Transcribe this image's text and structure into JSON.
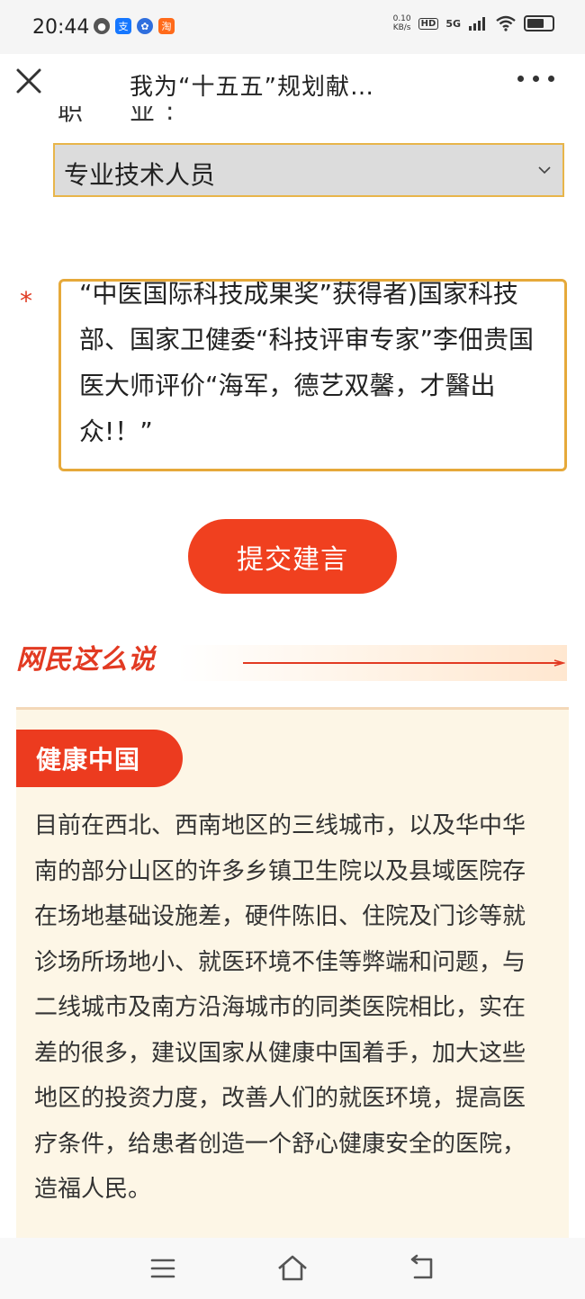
{
  "status_bar": {
    "time": "20:44",
    "net_speed_value": "0.10",
    "net_speed_unit": "KB/s",
    "hd": "HD",
    "network": "5G",
    "app_icons": [
      "wechat-icon",
      "alipay-icon",
      "baidu-icon",
      "taobao-icon"
    ]
  },
  "title_bar": {
    "title": "我为“十五五”规划献…"
  },
  "form": {
    "occupation_label": "职　业:",
    "occupation_value": "专业技术人员",
    "required_mark": "*",
    "suggestion_text": "“中医国际科技成果奖”获得者)国家科技部、国家卫健委“科技评审专家”李佃贵国医大师评价“海军，德艺双馨，才醫出众!！”",
    "submit_label": "提交建言"
  },
  "netizens": {
    "section_title": "网民这么说",
    "comments": [
      {
        "tag": "健康中国",
        "text": "目前在西北、西南地区的三线城市，以及华中华南的部分山区的许多乡镇卫生院以及县域医院存在场地基础设施差，硬件陈旧、住院及门诊等就诊场所场地小、就医环境不佳等弊端和问题，与二线城市及南方沿海城市的同类医院相比，实在差的很多，建议国家从健康中国着手，加大这些地区的投资力度，改善人们的就医环境，提高医疗条件，给患者创造一个舒心健康安全的医院，造福人民。"
      }
    ]
  },
  "colors": {
    "accent_red": "#f0401f",
    "border_gold": "#e6a93a",
    "card_bg": "#fdf6e6"
  }
}
